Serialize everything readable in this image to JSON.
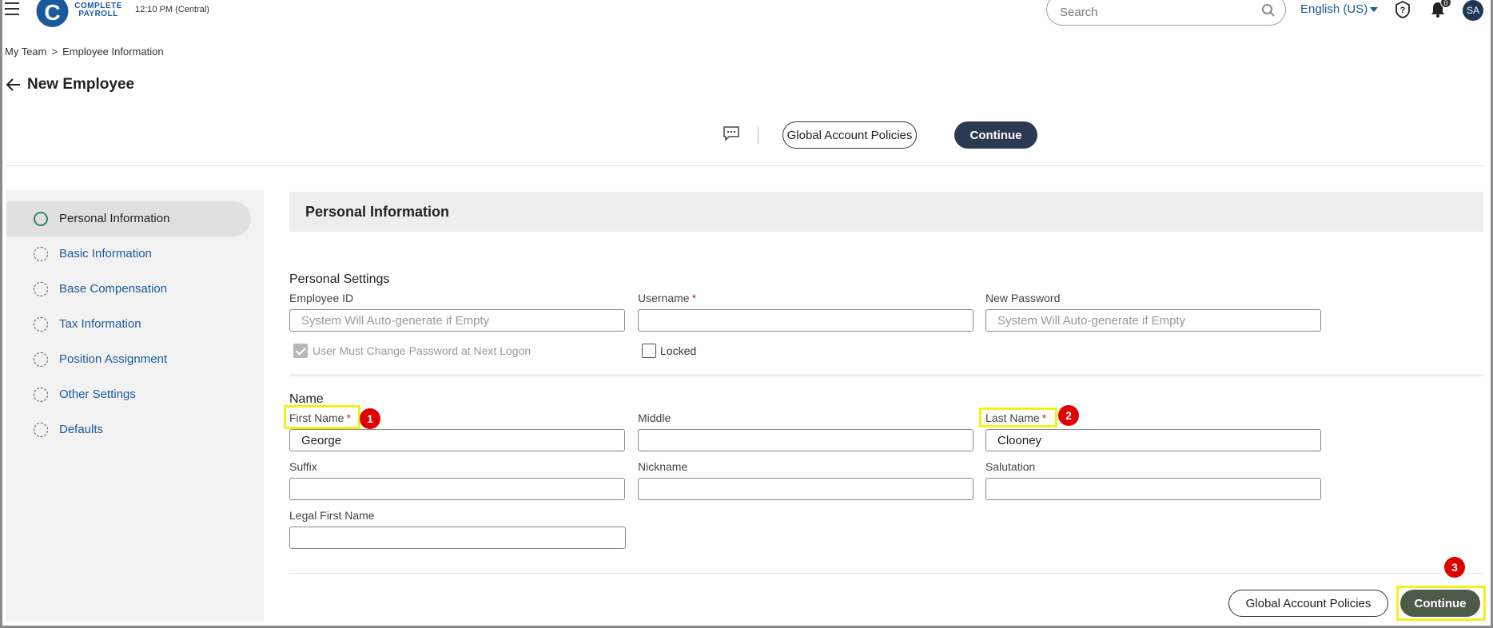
{
  "header": {
    "logo_letter": "C",
    "logo_line1": "COMPLETE",
    "logo_line2": "PAYROLL",
    "clock": "12:10 PM (Central)",
    "search_placeholder": "Search",
    "language": "English (US)",
    "notification_count": "0",
    "avatar_initials": "SA"
  },
  "breadcrumb": {
    "items": [
      "My Team",
      "Employee Information"
    ],
    "separator": ">"
  },
  "page": {
    "title": "New Employee"
  },
  "toolbar": {
    "policies_label": "Global Account Policies",
    "continue_label": "Continue"
  },
  "sidebar": {
    "items": [
      {
        "label": "Personal Information",
        "active": true
      },
      {
        "label": "Basic Information"
      },
      {
        "label": "Base Compensation"
      },
      {
        "label": "Tax Information"
      },
      {
        "label": "Position Assignment"
      },
      {
        "label": "Other Settings"
      },
      {
        "label": "Defaults"
      }
    ]
  },
  "main": {
    "section_title": "Personal Information",
    "personal_settings": {
      "title": "Personal Settings",
      "employee_id": {
        "label": "Employee ID",
        "placeholder": "System Will Auto-generate if Empty",
        "value": ""
      },
      "username": {
        "label": "Username",
        "required": "*",
        "value": ""
      },
      "new_password": {
        "label": "New Password",
        "placeholder": "System Will Auto-generate if Empty",
        "value": ""
      },
      "must_change": {
        "label": "User Must Change Password at Next Logon",
        "checked": true
      },
      "locked": {
        "label": "Locked",
        "checked": false
      }
    },
    "name": {
      "title": "Name",
      "first_name": {
        "label": "First Name",
        "required": "*",
        "value": "George"
      },
      "middle": {
        "label": "Middle",
        "value": ""
      },
      "last_name": {
        "label": "Last Name",
        "required": "*",
        "value": "Clooney"
      },
      "suffix": {
        "label": "Suffix",
        "value": ""
      },
      "nickname": {
        "label": "Nickname",
        "value": ""
      },
      "salutation": {
        "label": "Salutation",
        "value": ""
      },
      "legal_first_name": {
        "label": "Legal First Name",
        "value": ""
      }
    }
  },
  "footer": {
    "policies_label": "Global Account Policies",
    "continue_label": "Continue"
  },
  "annotations": {
    "markers": [
      "1",
      "2",
      "3"
    ],
    "highlight_color": "#f2f21a",
    "marker_color": "#e00000"
  },
  "colors": {
    "brand": "#1a5a9c",
    "dark_button": "#2b3a52",
    "footer_continue": "#4e5a49",
    "required": "#c62828"
  }
}
